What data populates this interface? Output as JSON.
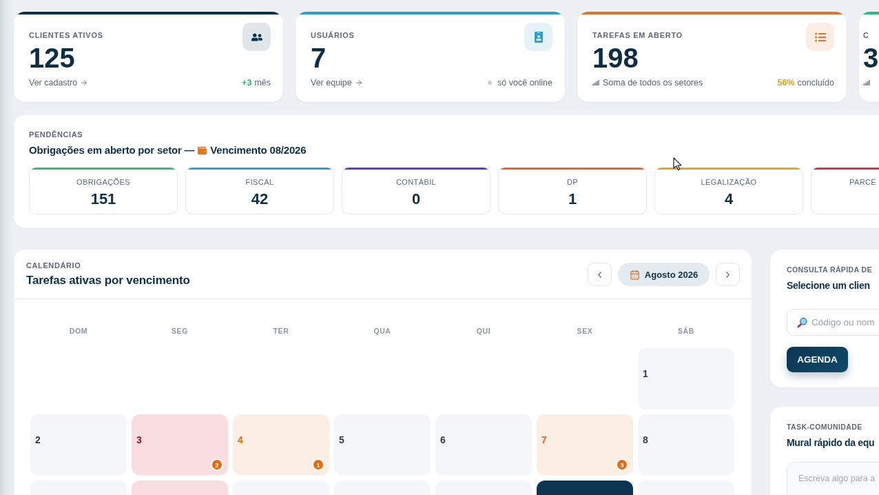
{
  "stat_cards": [
    {
      "label": "CLIENTES ATIVOS",
      "value": "125",
      "color": "#0b3150",
      "footer": {
        "kind": "link",
        "text": "Ver cadastro"
      },
      "side": {
        "kind": "gain",
        "value": "+3",
        "text": "mês"
      }
    },
    {
      "label": "USUÁRIOS",
      "value": "7",
      "color": "#2a9fd0",
      "footer": {
        "kind": "link",
        "text": "Ver equipe"
      },
      "side": {
        "kind": "status",
        "text": "só você online"
      }
    },
    {
      "label": "TAREFAS EM ABERTO",
      "value": "198",
      "color": "#e0742a",
      "footer": {
        "kind": "note",
        "text": "Soma de todos os setores"
      },
      "side": {
        "kind": "progress",
        "value": "56%",
        "text": "concluído"
      }
    },
    {
      "label": "C",
      "value": "3",
      "color": "#2dbd7b",
      "footer": {
        "kind": "note"
      }
    }
  ],
  "pendencias": {
    "label": "PENDÊNCIAS",
    "title": "Obrigações em aberto por setor —",
    "due": "Vencimento 08/2026",
    "sectors": [
      {
        "label": "OBRIGAÇÕES",
        "value": "151",
        "color": "#2fbf7a"
      },
      {
        "label": "FISCAL",
        "value": "42",
        "color": "#27a2d3"
      },
      {
        "label": "CONTÁBIL",
        "value": "0",
        "color": "#6a32cf"
      },
      {
        "label": "DP",
        "value": "1",
        "color": "#e0662a"
      },
      {
        "label": "LEGALIZAÇÃO",
        "value": "4",
        "color": "#e3a52a"
      },
      {
        "label": "PARCE",
        "color": "#d8344a"
      }
    ]
  },
  "calendar": {
    "label": "CALENDÁRIO",
    "title": "Tarefas ativas por vencimento",
    "month": "Agosto 2026",
    "weekdays": [
      "DOM",
      "SEG",
      "TER",
      "QUA",
      "QUI",
      "SEX",
      "SÁB"
    ],
    "weeks": [
      [
        {
          "kind": "empty"
        },
        {
          "kind": "empty"
        },
        {
          "kind": "empty"
        },
        {
          "kind": "empty"
        },
        {
          "kind": "empty"
        },
        {
          "kind": "empty"
        },
        {
          "kind": "plain",
          "day": "1"
        }
      ],
      [
        {
          "kind": "plain",
          "day": "2"
        },
        {
          "kind": "overdue",
          "day": "3",
          "count": "2"
        },
        {
          "kind": "due",
          "day": "4",
          "count": "1"
        },
        {
          "kind": "plain",
          "day": "5"
        },
        {
          "kind": "plain",
          "day": "6"
        },
        {
          "kind": "due",
          "day": "7",
          "count": "3"
        },
        {
          "kind": "plain",
          "day": "8"
        }
      ],
      [
        {
          "kind": "plain"
        },
        {
          "kind": "overdue"
        },
        {
          "kind": "plain"
        },
        {
          "kind": "plain"
        },
        {
          "kind": "plain"
        },
        {
          "kind": "today"
        },
        {
          "kind": "plain"
        }
      ]
    ]
  },
  "quick_search": {
    "label": "CONSULTA RÁPIDA DE",
    "title": "Selecione um clien",
    "placeholder": "Código ou nom",
    "button": "AGENDA"
  },
  "community": {
    "label": "TASK-COMUNIDADE",
    "title": "Mural rápido da equ",
    "placeholder": "Escreva algo para a"
  }
}
